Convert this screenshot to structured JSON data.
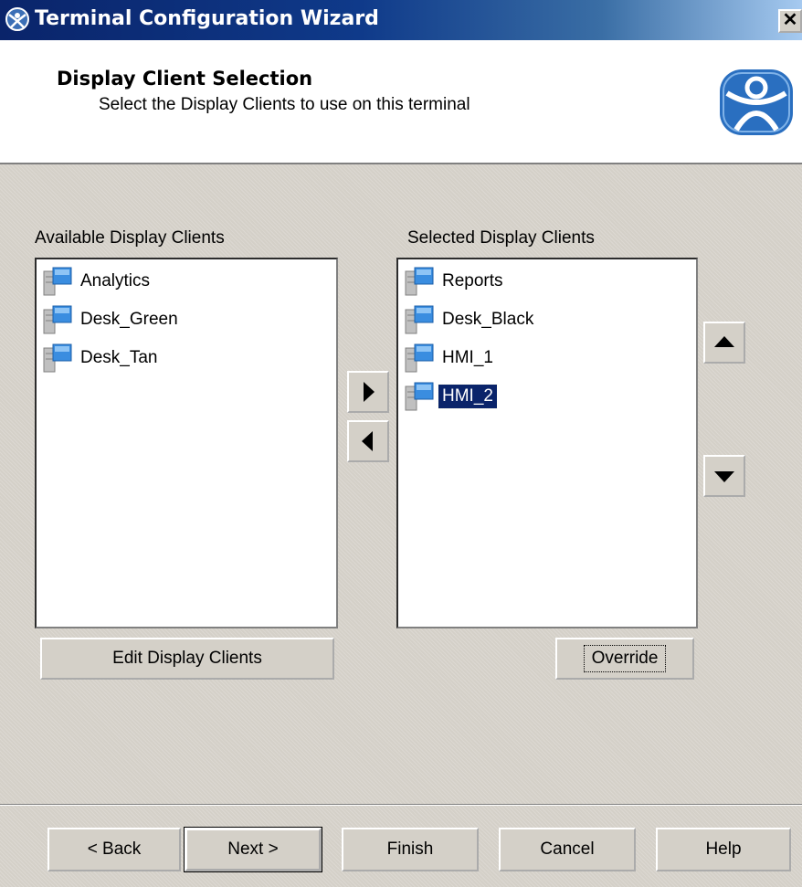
{
  "window": {
    "title": "Terminal Configuration Wizard",
    "close_label": "✕"
  },
  "header": {
    "title": "Display Client Selection",
    "subtitle": "Select the Display Clients to use on this terminal"
  },
  "available": {
    "label": "Available Display Clients",
    "items": [
      "Analytics",
      "Desk_Green",
      "Desk_Tan"
    ]
  },
  "selected": {
    "label": "Selected Display Clients",
    "items": [
      "Reports",
      "Desk_Black",
      "HMI_1",
      "HMI_2"
    ],
    "selected_item": "HMI_2"
  },
  "buttons": {
    "edit": "Edit Display Clients",
    "override": "Override",
    "back": "< Back",
    "next": "Next >",
    "finish": "Finish",
    "cancel": "Cancel",
    "help": "Help"
  },
  "icons": {
    "title": "thinmanager-icon",
    "logo": "thinmanager-logo",
    "item": "display-client-icon",
    "move_right": "arrow-right-icon",
    "move_left": "arrow-left-icon",
    "move_up": "arrow-up-icon",
    "move_down": "arrow-down-icon"
  },
  "colors": {
    "titlebar": "#0a246a",
    "selection": "#0a246a",
    "face": "#d4d0c8",
    "logo": "#2a6fc0"
  }
}
